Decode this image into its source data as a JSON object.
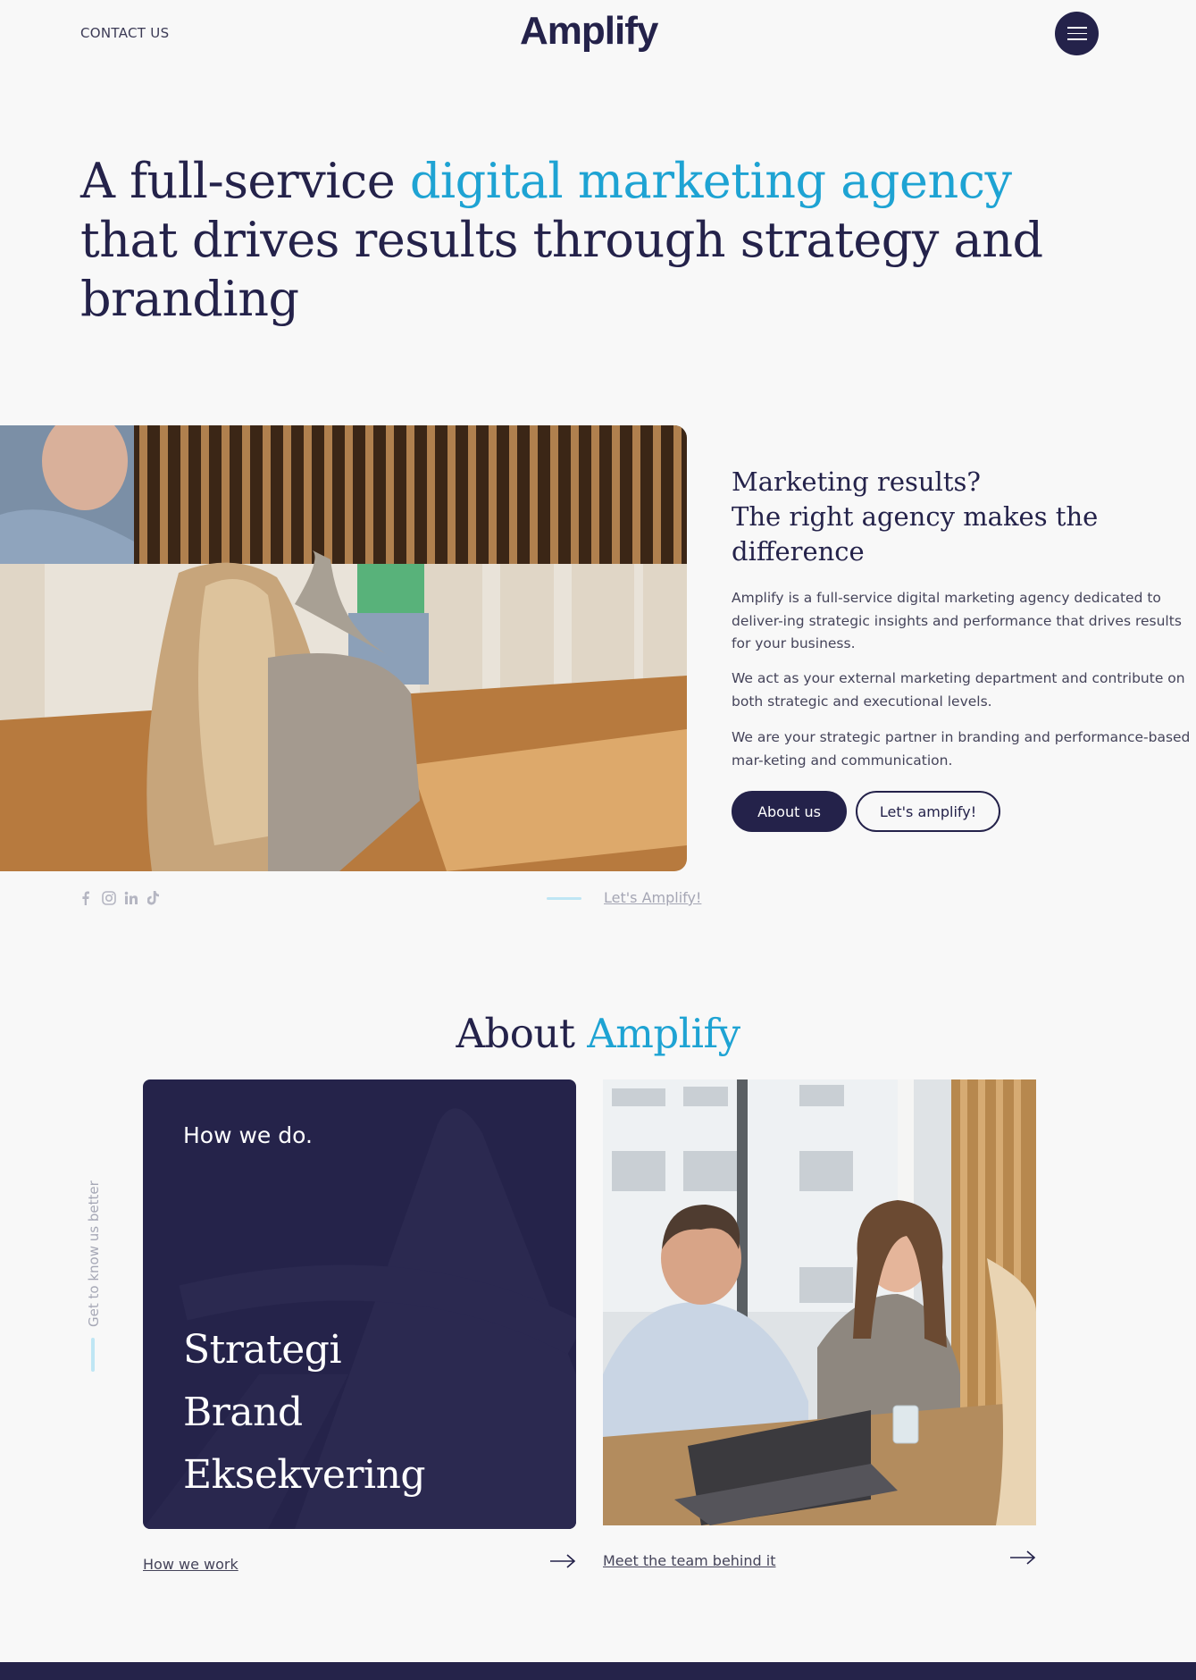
{
  "header": {
    "contact_label": "CONTACT US",
    "logo_text": "Amplify",
    "menu_icon": "hamburger-menu-icon"
  },
  "hero": {
    "title_part1": "A full-service ",
    "title_accent": "digital marketing agency",
    "title_part2": " that drives results through strategy and branding"
  },
  "intro": {
    "heading_line1": "Marketing results?",
    "heading_line2": "The right agency makes the difference",
    "paragraphs": [
      "Amplify is a full-service digital marketing agency dedicated to deliver-ing strategic insights and performance that drives results for your business.",
      "We act as your external marketing department and contribute on both strategic and executional levels.",
      "We are your strategic partner in branding and performance-based mar-keting and communication."
    ],
    "about_button": "About us",
    "amplify_button": "Let's amplify!"
  },
  "social": {
    "icons": [
      "facebook-icon",
      "instagram-icon",
      "linkedin-icon",
      "tiktok-icon"
    ],
    "lets_amplify": "Let's Amplify!"
  },
  "about": {
    "title_part1": "About ",
    "title_accent": "Amplify",
    "side_label": "Get to know us better",
    "card": {
      "subtitle": "How we do.",
      "items": [
        "Strategi",
        "Brand",
        "Eksekvering"
      ]
    },
    "how_we_work": "How we work",
    "meet_team": "Meet the team behind it"
  },
  "colors": {
    "navy": "#24224a",
    "accent": "#1ea3d3",
    "background": "#f8f8f8"
  }
}
